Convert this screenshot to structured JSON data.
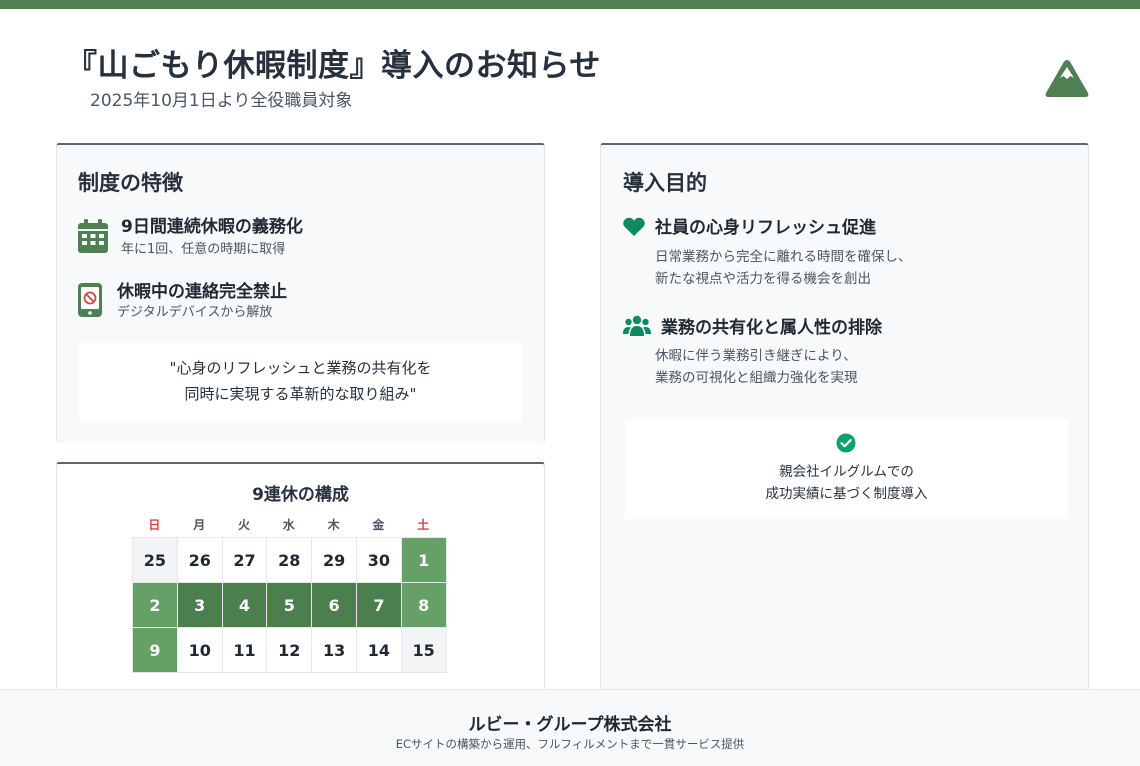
{
  "header": {
    "title": "『山ごもり休暇制度』導入のお知らせ",
    "subtitle": "2025年10月1日より全役職員対象",
    "logo_icon": "mountain-icon"
  },
  "features": {
    "title": "制度の特徴",
    "items": [
      {
        "icon": "calendar-icon",
        "heading": "9日間連続休暇の義務化",
        "description": "年に1回、任意の時期に取得"
      },
      {
        "icon": "phone-blocked-icon",
        "heading": "休暇中の連絡完全禁止",
        "description": "デジタルデバイスから解放"
      }
    ],
    "quote_line1": "\"心身のリフレッシュと業務の共有化を",
    "quote_line2": "同時に実現する革新的な取り組み\""
  },
  "purpose": {
    "title": "導入目的",
    "items": [
      {
        "icon": "heart-icon",
        "heading": "社員の心身リフレッシュ促進",
        "line1": "日常業務から完全に離れる時間を確保し、",
        "line2": "新たな視点や活力を得る機会を創出"
      },
      {
        "icon": "users-icon",
        "heading": "業務の共有化と属人性の排除",
        "line1": "休暇に伴う業務引き継ぎにより、",
        "line2": "業務の可視化と組織力強化を実現"
      }
    ],
    "success_icon": "check-circle-icon",
    "success_line1": "親会社イルグルムでの",
    "success_line2": "成功実績に基づく制度導入"
  },
  "calendar": {
    "title": "9連休の構成",
    "weekdays": [
      "日",
      "月",
      "火",
      "水",
      "木",
      "金",
      "土"
    ],
    "weeks": [
      [
        "25",
        "26",
        "27",
        "28",
        "29",
        "30",
        "1"
      ],
      [
        "2",
        "3",
        "4",
        "5",
        "6",
        "7",
        "8"
      ],
      [
        "9",
        "10",
        "11",
        "12",
        "13",
        "14",
        "15"
      ]
    ],
    "cell_states": [
      [
        "muted",
        "normal",
        "normal",
        "normal",
        "normal",
        "normal",
        "weekend"
      ],
      [
        "weekend",
        "leave",
        "leave",
        "leave",
        "leave",
        "leave",
        "weekend"
      ],
      [
        "weekend",
        "normal",
        "normal",
        "normal",
        "normal",
        "normal",
        "muted"
      ]
    ]
  },
  "footer": {
    "company": "ルビー・グループ株式会社",
    "tagline": "ECサイトの構築から運用、フルフィルメントまで一貫サービス提供"
  },
  "colors": {
    "brand_green": "#4f7f52",
    "leave_green": "#4b7f4e",
    "weekend_green": "#65a067",
    "success_green": "#0e9f6e",
    "sunday_saturday_red": "#d64545"
  }
}
